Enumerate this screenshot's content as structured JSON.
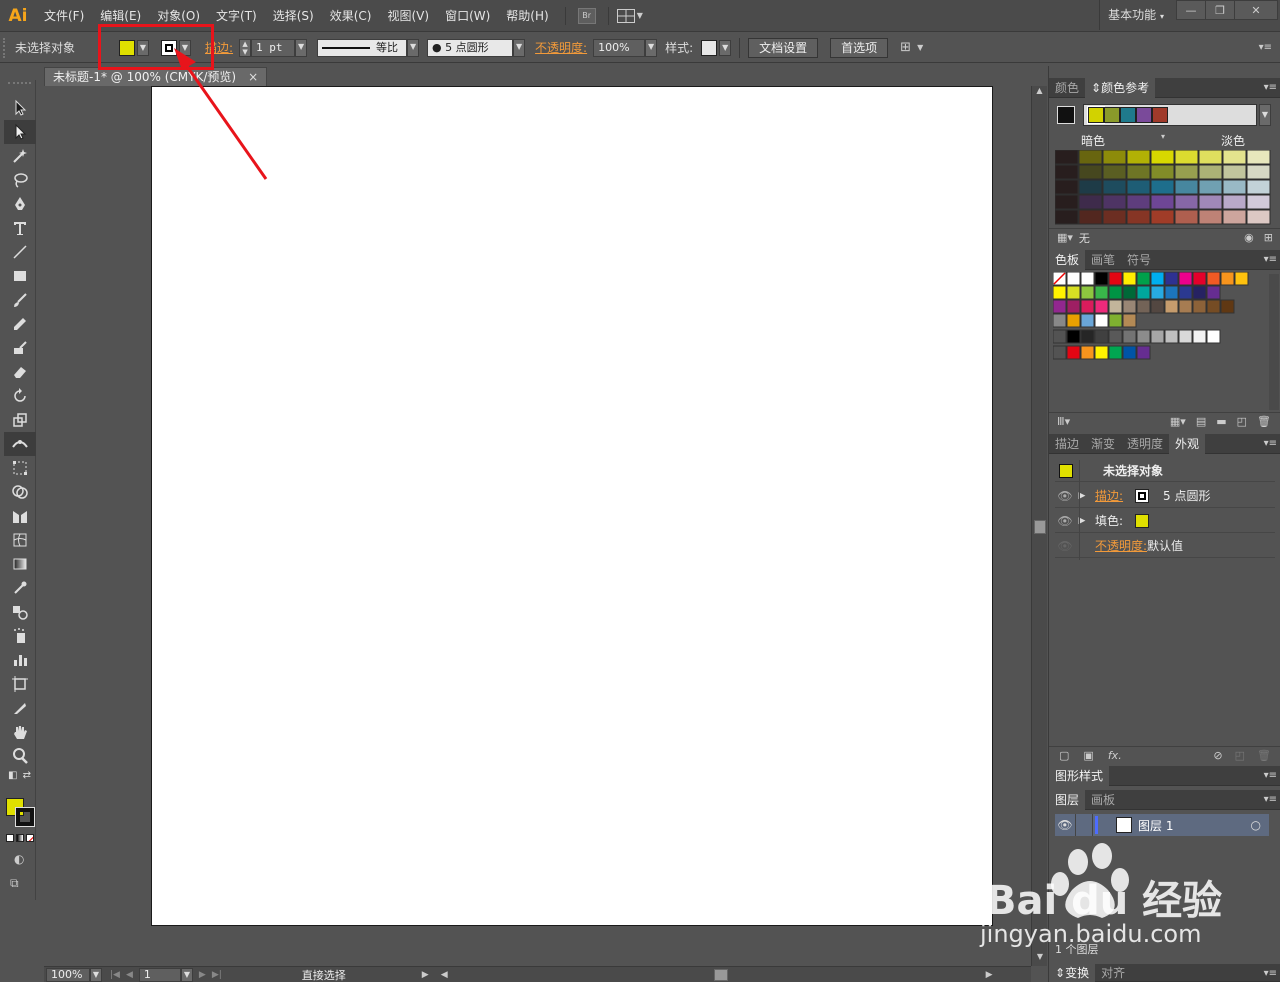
{
  "app": {
    "logo": "Ai"
  },
  "menubar": {
    "items": [
      "文件(F)",
      "编辑(E)",
      "对象(O)",
      "文字(T)",
      "选择(S)",
      "效果(C)",
      "视图(V)",
      "窗口(W)",
      "帮助(H)"
    ],
    "br_label": "Br",
    "workspace": "基本功能"
  },
  "controlbar": {
    "selection_label": "未选择对象",
    "fill_color": "#e0e000",
    "stroke_label": "描边:",
    "stroke_weight": "1 pt",
    "stroke_profile": "等比",
    "brush": "5 点圆形",
    "opacity_label": "不透明度:",
    "opacity_value": "100%",
    "style_label": "样式:",
    "doc_setup": "文档设置",
    "preferences": "首选项"
  },
  "document": {
    "tab_title": "未标题-1* @ 100% (CMYK/预览)",
    "close_glyph": "×",
    "zoom": "100%",
    "page": "1",
    "status_tool": "直接选择"
  },
  "color_panel": {
    "tab_color": "颜色",
    "tab_guide": "颜色参考",
    "guide_colors": [
      "#d2d200",
      "#8a9a2a",
      "#1f7a8c",
      "#7a4a9a",
      "#a03a2a"
    ],
    "dark_label": "暗色",
    "light_label": "淡色",
    "foot_none": "无"
  },
  "swatches_panel": {
    "tabs": [
      "色板",
      "画笔",
      "符号"
    ]
  },
  "appearance_panel": {
    "tabs": [
      "描边",
      "渐变",
      "透明度",
      "外观"
    ],
    "title": "未选择对象",
    "stroke_label": "描边:",
    "stroke_value": "5 点圆形",
    "fill_label": "填色:",
    "opacity_label": "不透明度:",
    "opacity_value": "默认值",
    "fx": "fx."
  },
  "graphic_styles": {
    "tab": "图形样式"
  },
  "layers_panel": {
    "tabs": [
      "图层",
      "画板"
    ],
    "layer_name": "图层 1",
    "footer": "1 个图层"
  },
  "bottom_tabs": [
    "变换",
    "对齐"
  ],
  "watermark": {
    "text": "jingyan.baidu.com",
    "logo_text": "Bai du 经验"
  }
}
